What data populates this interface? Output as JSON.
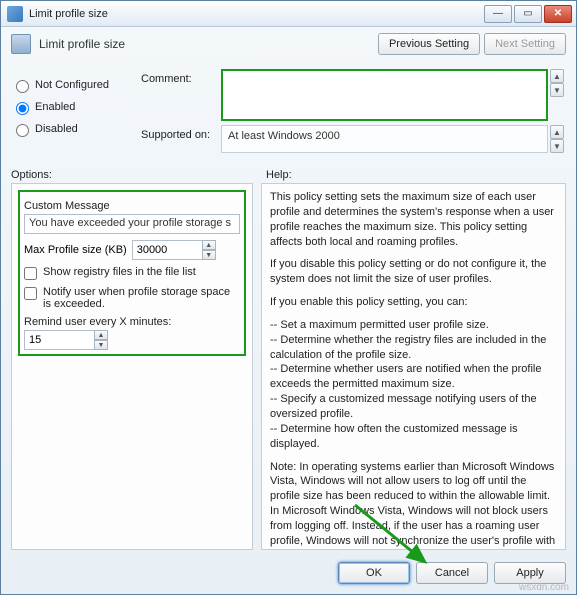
{
  "window": {
    "title": "Limit profile size"
  },
  "header": {
    "title": "Limit profile size",
    "prev": "Previous Setting",
    "next": "Next Setting"
  },
  "config": {
    "radios": {
      "not_configured": "Not Configured",
      "enabled": "Enabled",
      "disabled": "Disabled"
    },
    "selected": "enabled",
    "comment_label": "Comment:",
    "supported_label": "Supported on:",
    "supported_value": "At least Windows 2000"
  },
  "labels": {
    "options": "Options:",
    "help": "Help:"
  },
  "options": {
    "custom_message_label": "Custom Message",
    "custom_message_value": "You have exceeded your profile storage s",
    "max_profile_label": "Max Profile size (KB)",
    "max_profile_value": "30000",
    "show_registry": "Show registry files in the file list",
    "notify_user": "Notify user when profile storage space is exceeded.",
    "remind_label": "Remind user every X minutes:",
    "remind_value": "15"
  },
  "help": {
    "p1": "This policy setting sets the maximum size of each user profile and determines the system's response when a user profile reaches the maximum size. This policy setting affects both local and roaming profiles.",
    "p2": "If you disable this policy setting or do not configure it, the system does not limit the size of user profiles.",
    "p3": "If you enable this policy setting, you can:",
    "p4": "-- Set a maximum permitted user profile size.\n-- Determine whether the registry files are included in the calculation of the profile size.\n-- Determine whether users are notified when the profile exceeds the permitted maximum size.\n-- Specify a customized message notifying users of the oversized profile.\n-- Determine how often the customized message is displayed.",
    "p5": "Note: In operating systems earlier than Microsoft Windows Vista, Windows will not allow users to log off until the profile size has been reduced to within the allowable limit. In Microsoft Windows Vista, Windows will not block users from logging off. Instead, if the user has a roaming user profile, Windows will not synchronize the user's profile with the roaming profile server if the maximum profile size limit specified here is exceeded."
  },
  "footer": {
    "ok": "OK",
    "cancel": "Cancel",
    "apply": "Apply"
  },
  "watermark": "wsxdn.com"
}
